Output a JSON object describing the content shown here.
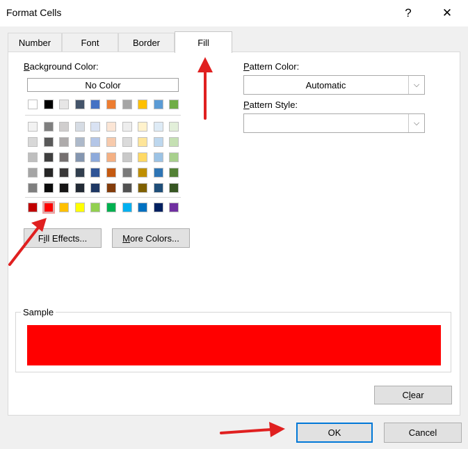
{
  "window": {
    "title": "Format Cells",
    "help_glyph": "?",
    "close_glyph": "✕"
  },
  "tabs": [
    {
      "label": "Number",
      "active": false
    },
    {
      "label": "Font",
      "active": false
    },
    {
      "label": "Border",
      "active": false
    },
    {
      "label": "Fill",
      "active": true
    }
  ],
  "background": {
    "label": "Background Color:",
    "no_color": "No Color",
    "top_row": [
      "#ffffff",
      "#000000",
      "#e7e6e6",
      "#44546a",
      "#4472c4",
      "#ed7d31",
      "#a5a5a5",
      "#ffc000",
      "#5b9bd5",
      "#70ad47"
    ],
    "tint_rows": [
      [
        "#f2f2f2",
        "#7f7f7f",
        "#d0cece",
        "#d6dce4",
        "#d9e2f3",
        "#fbe5d5",
        "#ededed",
        "#fff2cc",
        "#deebf6",
        "#e2efd9"
      ],
      [
        "#d8d8d8",
        "#595959",
        "#aeabab",
        "#adb9ca",
        "#b4c6e7",
        "#f7caac",
        "#dbdbdb",
        "#fee599",
        "#bdd7ee",
        "#c5e0b3"
      ],
      [
        "#bfbfbf",
        "#3f3f3f",
        "#757070",
        "#8496b0",
        "#8eaadb",
        "#f4b083",
        "#c9c9c9",
        "#ffd965",
        "#9cc3e5",
        "#a8d08d"
      ],
      [
        "#a5a5a5",
        "#262626",
        "#3a3838",
        "#323f4f",
        "#2f5496",
        "#c55a11",
        "#7b7b7b",
        "#bf8f00",
        "#2e75b5",
        "#538135"
      ],
      [
        "#7f7f7f",
        "#0c0c0c",
        "#171616",
        "#222a35",
        "#1f3864",
        "#833c0b",
        "#525252",
        "#7f6000",
        "#1f4e79",
        "#375623"
      ]
    ],
    "standard_row": [
      "#c00000",
      "#ff0000",
      "#ffc000",
      "#ffff00",
      "#92d050",
      "#00b050",
      "#00b0f0",
      "#0070c0",
      "#002060",
      "#7030a0"
    ],
    "selected_color": "#ff0000"
  },
  "buttons": {
    "fill_effects": "Fill Effects...",
    "more_colors": "More Colors...",
    "clear": "Clear",
    "ok": "OK",
    "cancel": "Cancel"
  },
  "pattern": {
    "color_label": "Pattern Color:",
    "color_value": "Automatic",
    "style_label": "Pattern Style:",
    "style_value": ""
  },
  "sample": {
    "label": "Sample",
    "color": "#ff0000"
  },
  "annotation_color": "#e02020"
}
